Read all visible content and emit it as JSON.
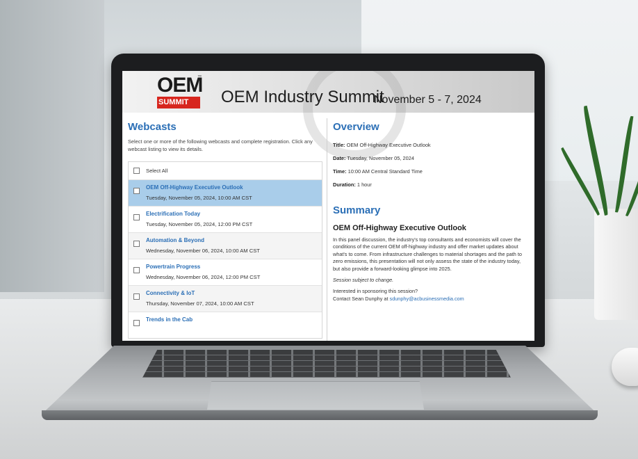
{
  "page": {
    "banner": {
      "logo_text": "OEM",
      "logo_subtext": "SUMMIT",
      "title": "OEM Industry Summit",
      "dates": "November 5 - 7, 2024"
    },
    "webcasts": {
      "heading": "Webcasts",
      "intro": "Select one or more of the following webcasts and complete registration. Click any webcast listing to view its details.",
      "select_all": "Select All",
      "items": [
        {
          "title": "OEM Off-Highway Executive Outlook",
          "date": "Tuesday, November 05, 2024, 10:00 AM CST",
          "selected": true
        },
        {
          "title": "Electrification Today",
          "date": "Tuesday, November 05, 2024, 12:00 PM CST",
          "selected": false
        },
        {
          "title": "Automation & Beyond",
          "date": "Wednesday, November 06, 2024, 10:00 AM CST",
          "selected": false
        },
        {
          "title": "Powertrain Progress",
          "date": "Wednesday, November 06, 2024, 12:00 PM CST",
          "selected": false
        },
        {
          "title": "Connectivity & IoT",
          "date": "Thursday, November 07, 2024, 10:00 AM CST",
          "selected": false
        },
        {
          "title": "Trends in the Cab",
          "date": "",
          "selected": false
        }
      ]
    },
    "overview": {
      "heading": "Overview",
      "title_label": "Title:",
      "title_value": "OEM Off-Highway Executive Outlook",
      "date_label": "Date:",
      "date_value": "Tuesday, November 05, 2024",
      "time_label": "Time:",
      "time_value": "10:00 AM Central Standard Time",
      "duration_label": "Duration:",
      "duration_value": "1 hour"
    },
    "summary": {
      "heading": "Summary",
      "session_title": "OEM Off-Highway Executive Outlook",
      "description": "In this panel discussion, the industry's top consultants and economists will cover the conditions of the current OEM off-highway industry and offer market updates about what's to come. From infrastructure challenges to material shortages and the path to zero emissions, this presentation will not only assess the state of the industry today, but also provide a forward-looking glimpse into 2025.",
      "note": "Session subject to change.",
      "sponsor_question": "Interested in sponsoring this session?",
      "contact_prefix": "Contact Sean Dunphy at",
      "contact_email": "sdunphy@acbusinessmedia.com"
    }
  },
  "colors": {
    "accent": "#2b6fb6",
    "selected_row": "#a9cdea",
    "logo_red": "#d7261e"
  }
}
